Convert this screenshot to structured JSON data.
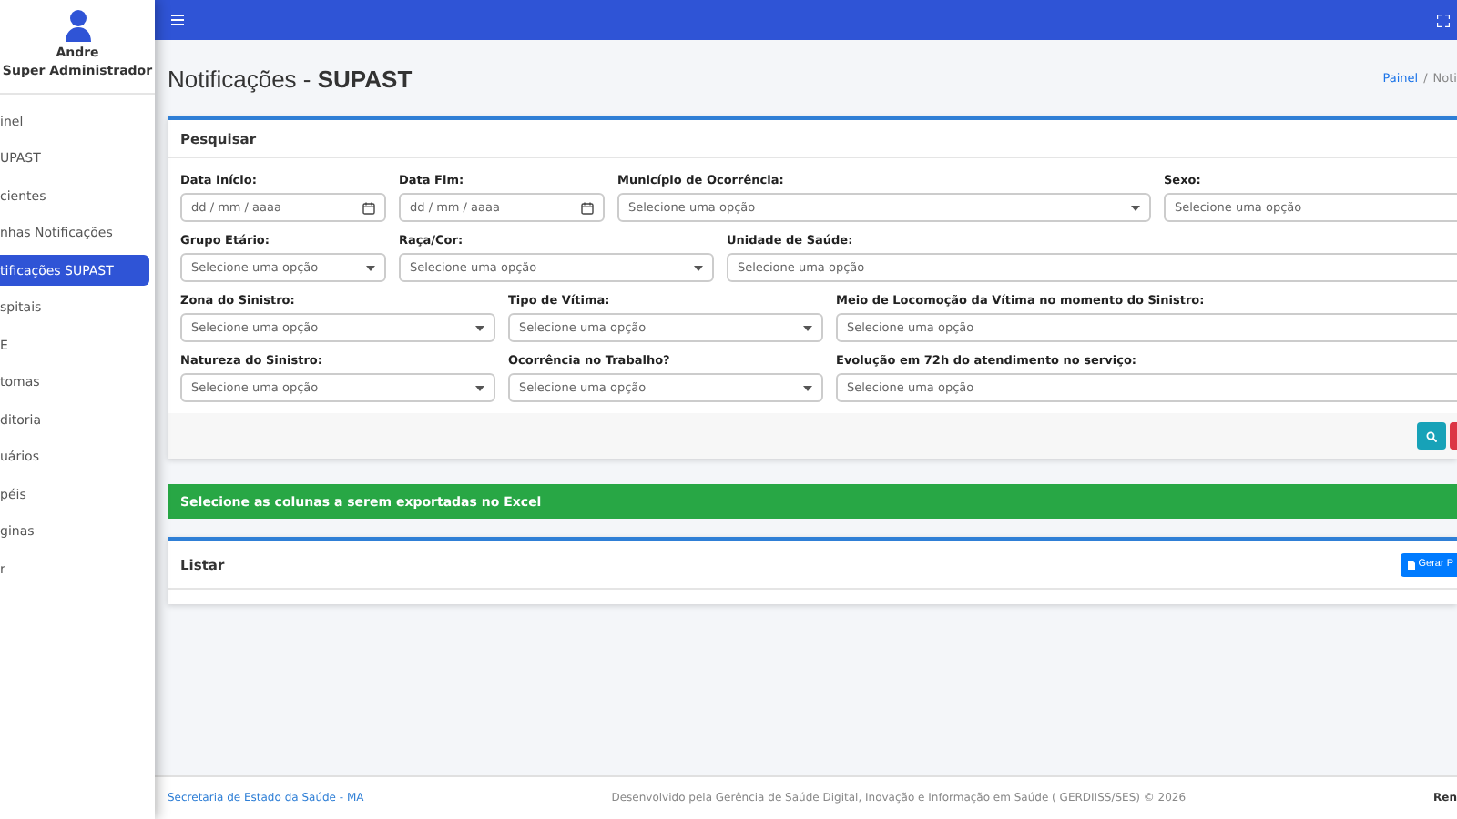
{
  "user": {
    "name": "Andre",
    "role": "Super Administrador"
  },
  "sidebar": {
    "items": [
      {
        "label": "inel",
        "selected": false
      },
      {
        "label": "UPAST",
        "selected": false
      },
      {
        "label": "cientes",
        "selected": false
      },
      {
        "label": "nhas Notificações",
        "selected": false
      },
      {
        "label": "tificações SUPAST",
        "selected": true
      },
      {
        "label": "spitais",
        "selected": false
      },
      {
        "label": "E",
        "selected": false
      },
      {
        "label": "tomas",
        "selected": false
      },
      {
        "label": "ditoria",
        "selected": false
      },
      {
        "label": "uários",
        "selected": false
      },
      {
        "label": "péis",
        "selected": false
      },
      {
        "label": "ginas",
        "selected": false
      },
      {
        "label": "r",
        "selected": false
      }
    ]
  },
  "page": {
    "title": "Notificações - ",
    "title_bold": "SUPAST",
    "breadcrumb": [
      "Painel",
      "/",
      "Noti"
    ]
  },
  "search_card": {
    "title": "Pesquisar",
    "rows": [
      [
        {
          "label": "Data Início:",
          "kind": "date",
          "placeholder": "dd / mm / aaaa"
        },
        {
          "label": "Data Fim:",
          "kind": "date",
          "placeholder": "dd / mm / aaaa"
        },
        {
          "label": "Município de Ocorrência:",
          "kind": "select",
          "placeholder": "Selecione uma opção"
        },
        {
          "label": "Sexo:",
          "kind": "text",
          "placeholder": "Selecione uma opção"
        }
      ],
      [
        {
          "label": "Grupo Etário:",
          "kind": "select",
          "placeholder": "Selecione uma opção"
        },
        {
          "label": "Raça/Cor:",
          "kind": "select",
          "placeholder": "Selecione uma opção"
        },
        {
          "label": "Unidade de Saúde:",
          "kind": "text",
          "placeholder": "Selecione uma opção"
        }
      ],
      [
        {
          "label": "Zona do Sinistro:",
          "kind": "select",
          "placeholder": "Selecione uma opção"
        },
        {
          "label": "Tipo de Vítima:",
          "kind": "select",
          "placeholder": "Selecione uma opção"
        },
        {
          "label": "Meio de Locomoção da Vítima no momento do Sinistro:",
          "kind": "text",
          "placeholder": "Selecione uma opção"
        }
      ],
      [
        {
          "label": "Natureza do Sinistro:",
          "kind": "select",
          "placeholder": "Selecione uma opção"
        },
        {
          "label": "Ocorrência no Trabalho?",
          "kind": "select",
          "placeholder": "Selecione uma opção"
        },
        {
          "label": "Evolução em 72h do atendimento no serviço:",
          "kind": "text",
          "placeholder": "Selecione uma opção"
        }
      ]
    ]
  },
  "export_banner": "Selecione as colunas a serem exportadas no Excel",
  "list_card": {
    "title": "Listar",
    "button": "Gerar P"
  },
  "footer": {
    "left": "Secretaria de Estado da Saúde - MA",
    "center": "Desenvolvido pela Gerência de Saúde Digital, Inovação e Informação em Saúde ( GERDIISS/SES) © 2026",
    "right": "Ren"
  }
}
